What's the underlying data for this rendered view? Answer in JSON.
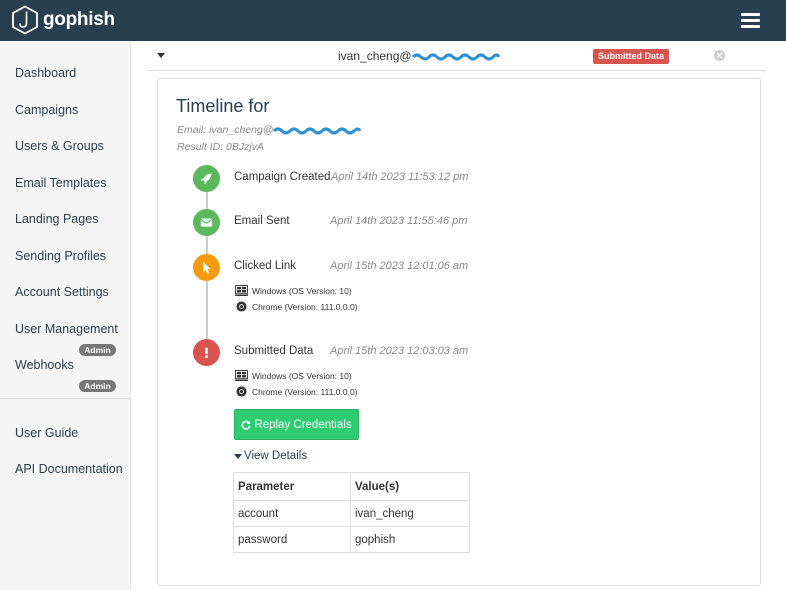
{
  "app": {
    "brand": "gophish"
  },
  "sidebar": {
    "items": [
      {
        "label": "Dashboard"
      },
      {
        "label": "Campaigns"
      },
      {
        "label": "Users & Groups"
      },
      {
        "label": "Email Templates"
      },
      {
        "label": "Landing Pages"
      },
      {
        "label": "Sending Profiles"
      },
      {
        "label": "Account Settings"
      },
      {
        "label": "User Management",
        "badge": "Admin"
      },
      {
        "label": "Webhooks",
        "badge": "Admin"
      }
    ],
    "footer_items": [
      {
        "label": "User Guide"
      },
      {
        "label": "API Documentation"
      }
    ]
  },
  "result_row": {
    "email_prefix": "ivan_cheng@",
    "status": "Submitted Data"
  },
  "timeline": {
    "title": "Timeline for",
    "email_line": "Email: ivan_cheng@",
    "result_id_line": "Result ID: 0BJzjvA",
    "events": [
      {
        "name": "Campaign Created",
        "time": "April 14th 2023 11:53:12 pm",
        "icon": "rocket-icon",
        "color": "#5cb85c"
      },
      {
        "name": "Email Sent",
        "time": "April 14th 2023 11:55:46 pm",
        "icon": "envelope-icon",
        "color": "#5cb85c"
      },
      {
        "name": "Clicked Link",
        "time": "April 15th 2023 12:01:06 am",
        "icon": "cursor-icon",
        "color": "#f39c12",
        "os": "Windows (OS Version: 10)",
        "browser": "Chrome (Version: 111.0.0.0)"
      },
      {
        "name": "Submitted Data",
        "time": "April 15th 2023 12:03:03 am",
        "icon": "exclamation-icon",
        "color": "#d9534f",
        "os": "Windows (OS Version: 10)",
        "browser": "Chrome (Version: 111.0.0.0)"
      }
    ],
    "replay_button": "Replay Credentials",
    "view_details": "View Details",
    "table": {
      "headers": [
        "Parameter",
        "Value(s)"
      ],
      "rows": [
        [
          "account",
          "ivan_cheng"
        ],
        [
          "password",
          "gophish"
        ]
      ]
    }
  },
  "colors": {
    "navbar": "#283f50",
    "success": "#5cb85c",
    "warning": "#f39c12",
    "danger": "#d9534f",
    "replay_button": "#2ecc71"
  }
}
